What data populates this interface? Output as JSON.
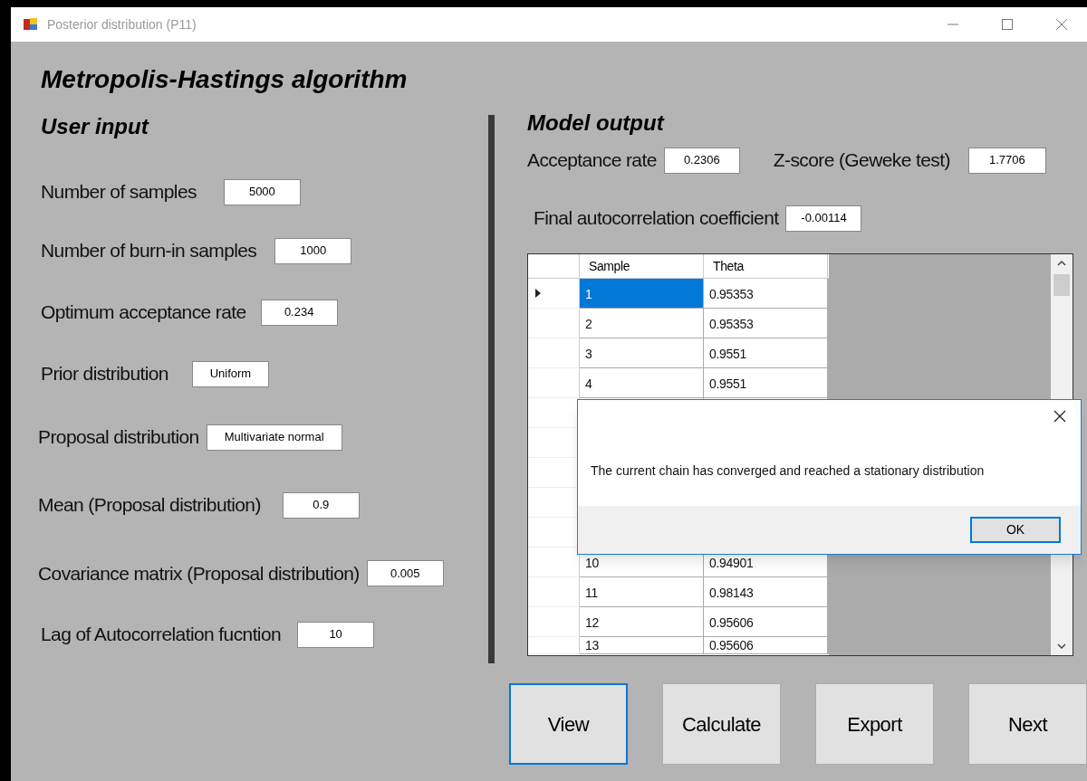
{
  "window": {
    "title": "Posterior distribution (P11)"
  },
  "heading": "Metropolis-Hastings algorithm",
  "user_input": {
    "title": "User input",
    "fields": [
      {
        "label": "Number of samples",
        "value": "5000"
      },
      {
        "label": "Number of burn-in samples",
        "value": "1000"
      },
      {
        "label": "Optimum acceptance rate",
        "value": "0.234"
      },
      {
        "label": "Prior distribution",
        "value": "Uniform"
      },
      {
        "label": "Proposal distribution",
        "value": "Multivariate normal"
      },
      {
        "label": "Mean (Proposal distribution)",
        "value": "0.9"
      },
      {
        "label": "Covariance matrix (Proposal distribution)",
        "value": "0.005"
      },
      {
        "label": "Lag of Autocorrelation fucntion",
        "value": "10"
      }
    ]
  },
  "model_output": {
    "title": "Model output",
    "fields": [
      {
        "label": "Acceptance rate",
        "value": "0.2306"
      },
      {
        "label": "Z-score (Geweke test)",
        "value": "1.7706"
      },
      {
        "label": "Final autocorrelation coefficient",
        "value": "-0.00114"
      }
    ]
  },
  "table": {
    "columns": [
      "Sample",
      "Theta"
    ],
    "rows_top": [
      {
        "cells": [
          "1",
          "0.95353"
        ],
        "selected": true
      },
      {
        "cells": [
          "2",
          "0.95353"
        ],
        "selected": false
      },
      {
        "cells": [
          "3",
          "0.9551"
        ],
        "selected": false
      },
      {
        "cells": [
          "4",
          "0.9551"
        ],
        "selected": false
      }
    ],
    "rows_bottom": [
      {
        "cells": [
          "10",
          "0.94901"
        ],
        "selected": false
      },
      {
        "cells": [
          "11",
          "0.98143"
        ],
        "selected": false
      },
      {
        "cells": [
          "12",
          "0.95606"
        ],
        "selected": false
      },
      {
        "cells": [
          "13",
          "0.95606"
        ],
        "selected": false
      }
    ]
  },
  "dialog": {
    "message": "The current chain has converged and reached a stationary distribution",
    "button": "OK"
  },
  "buttons": [
    {
      "label": "View",
      "selected": true
    },
    {
      "label": "Calculate",
      "selected": false
    },
    {
      "label": "Export",
      "selected": false
    },
    {
      "label": "Next",
      "selected": false
    }
  ]
}
